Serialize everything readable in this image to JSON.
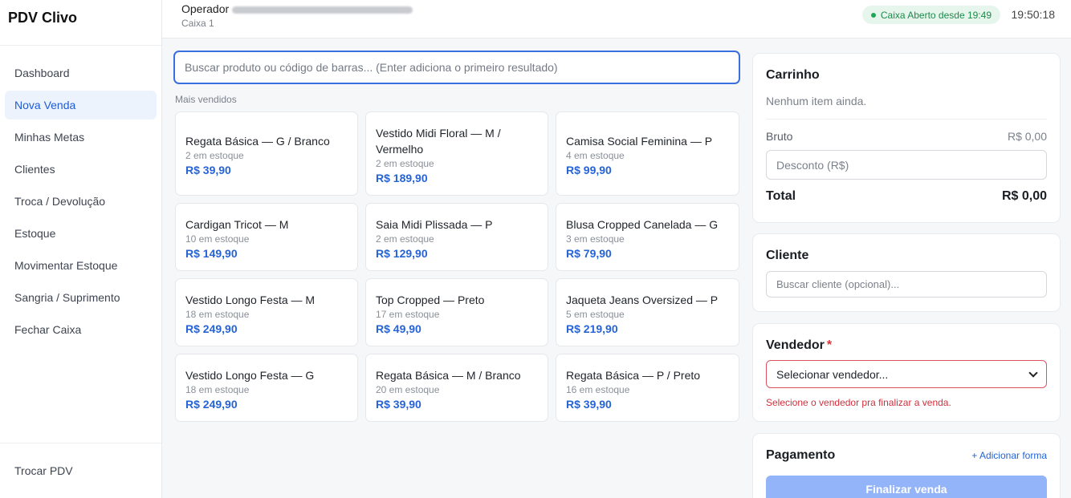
{
  "brand": "PDV Clivo",
  "nav": [
    {
      "label": "Dashboard",
      "active": false
    },
    {
      "label": "Nova Venda",
      "active": true
    },
    {
      "label": "Minhas Metas",
      "active": false
    },
    {
      "label": "Clientes",
      "active": false
    },
    {
      "label": "Troca / Devolução",
      "active": false
    },
    {
      "label": "Estoque",
      "active": false
    },
    {
      "label": "Movimentar Estoque",
      "active": false
    },
    {
      "label": "Sangria / Suprimento",
      "active": false
    },
    {
      "label": "Fechar Caixa",
      "active": false
    }
  ],
  "sidebar_footer": "Trocar PDV",
  "topbar": {
    "operator_label": "Operador",
    "register": "Caixa 1",
    "status": "Caixa Aberto desde 19:49",
    "clock": "19:50:18"
  },
  "search": {
    "placeholder": "Buscar produto ou código de barras... (Enter adiciona o primeiro resultado)",
    "value": ""
  },
  "section_label": "Mais vendidos",
  "products": [
    {
      "name": "Regata Básica — G / Branco",
      "stock": "2 em estoque",
      "price": "R$ 39,90"
    },
    {
      "name": "Vestido Midi Floral — M / Vermelho",
      "stock": "2 em estoque",
      "price": "R$ 189,90"
    },
    {
      "name": "Camisa Social Feminina — P",
      "stock": "4 em estoque",
      "price": "R$ 99,90"
    },
    {
      "name": "Cardigan Tricot — M",
      "stock": "10 em estoque",
      "price": "R$ 149,90"
    },
    {
      "name": "Saia Midi Plissada — P",
      "stock": "2 em estoque",
      "price": "R$ 129,90"
    },
    {
      "name": "Blusa Cropped Canelada — G",
      "stock": "3 em estoque",
      "price": "R$ 79,90"
    },
    {
      "name": "Vestido Longo Festa — M",
      "stock": "18 em estoque",
      "price": "R$ 249,90"
    },
    {
      "name": "Top Cropped — Preto",
      "stock": "17 em estoque",
      "price": "R$ 49,90"
    },
    {
      "name": "Jaqueta Jeans Oversized — P",
      "stock": "5 em estoque",
      "price": "R$ 219,90"
    },
    {
      "name": "Vestido Longo Festa — G",
      "stock": "18 em estoque",
      "price": "R$ 249,90"
    },
    {
      "name": "Regata Básica — M / Branco",
      "stock": "20 em estoque",
      "price": "R$ 39,90"
    },
    {
      "name": "Regata Básica — P / Preto",
      "stock": "16 em estoque",
      "price": "R$ 39,90"
    }
  ],
  "cart": {
    "title": "Carrinho",
    "empty": "Nenhum item ainda.",
    "gross_label": "Bruto",
    "gross_value": "R$ 0,00",
    "discount_placeholder": "Desconto (R$)",
    "total_label": "Total",
    "total_value": "R$ 0,00"
  },
  "customer": {
    "title": "Cliente",
    "placeholder": "Buscar cliente (opcional)..."
  },
  "seller": {
    "title": "Vendedor",
    "required_mark": "*",
    "selected": "Selecionar vendedor...",
    "error": "Selecione o vendedor pra finalizar a venda."
  },
  "payment": {
    "title": "Pagamento",
    "add_label": "+ Adicionar forma",
    "finish_label": "Finalizar venda"
  },
  "colors": {
    "accent": "#2563d6",
    "active_nav_bg": "#edf3fd",
    "status_green": "#1d8a4b",
    "error_red": "#d0303c",
    "finish_disabled": "#93b4f9"
  }
}
